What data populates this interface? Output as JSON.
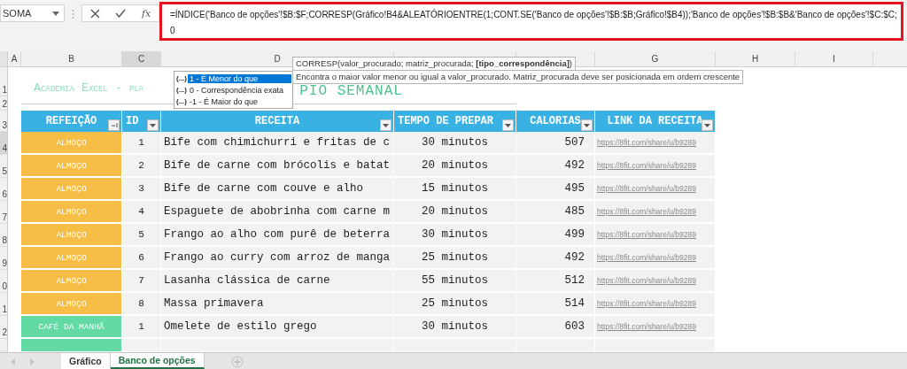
{
  "name_box": {
    "value": "SOMA"
  },
  "formula_bar": {
    "fx_label": "fx",
    "lines": [
      "=ÍNDICE('Banco de opções'!$B:$F;CORRESP(Gráfico!B4&ALEATÓRIOENTRE(1;CONT.SE('Banco de opções'!$B:$B;Gráfico!$B4));'Banco de opções'!$B:$B&'Banco de opções'!$C:$C;",
      "0"
    ]
  },
  "column_headers": [
    {
      "label": "A",
      "selected": false
    },
    {
      "label": "B",
      "selected": false
    },
    {
      "label": "C",
      "selected": true
    },
    {
      "label": "D",
      "selected": false
    },
    {
      "selected": false
    },
    {
      "selected": false
    },
    {
      "label": "G",
      "selected": false
    },
    {
      "label": "H",
      "selected": false
    },
    {
      "label": "I",
      "selected": false
    }
  ],
  "row_headers": [
    {
      "label": "1",
      "selected": false
    },
    {
      "label": "2",
      "selected": false
    },
    {
      "label": "3",
      "selected": false
    },
    {
      "label": "4",
      "selected": true
    },
    {
      "label": "5",
      "selected": false
    },
    {
      "label": "6",
      "selected": false
    },
    {
      "label": "7",
      "selected": false
    },
    {
      "label": "8",
      "selected": false
    },
    {
      "label": "9",
      "selected": false
    },
    {
      "label": "0",
      "selected": false
    },
    {
      "label": "1",
      "selected": false
    },
    {
      "label": "2",
      "selected": false
    }
  ],
  "title": {
    "left": "Academia Excel - pla",
    "right": "PIO SEMANAL"
  },
  "table": {
    "columns": [
      "REFEIÇÃO",
      "ID",
      "RECEITA",
      "TEMPO DE PREPAR",
      "CALORIAS",
      "LINK DA RECEITA"
    ],
    "rows": [
      {
        "meal": "ALMOÇO",
        "color": "#f6bd47",
        "id": "1",
        "recipe": "Bife com chimichurri e fritas de c",
        "time": "30 minutos",
        "calories": "507",
        "link": "https://8fit.com/share/u/b9289"
      },
      {
        "meal": "ALMOÇO",
        "color": "#f6bd47",
        "id": "2",
        "recipe": "Bife de carne com brócolis e batat",
        "time": "20 minutos",
        "calories": "492",
        "link": "https://8fit.com/share/u/b9289"
      },
      {
        "meal": "ALMOÇO",
        "color": "#f6bd47",
        "id": "3",
        "recipe": "Bife de carne com couve e alho",
        "time": "15 minutos",
        "calories": "495",
        "link": "https://8fit.com/share/u/b9289"
      },
      {
        "meal": "ALMOÇO",
        "color": "#f6bd47",
        "id": "4",
        "recipe": "Espaguete de abobrinha com carne m",
        "time": "20 minutos",
        "calories": "485",
        "link": "https://8fit.com/share/u/b9289"
      },
      {
        "meal": "ALMOÇO",
        "color": "#f6bd47",
        "id": "5",
        "recipe": "Frango ao alho com purê de beterra",
        "time": "30 minutos",
        "calories": "499",
        "link": "https://8fit.com/share/u/b9289"
      },
      {
        "meal": "ALMOÇO",
        "color": "#f6bd47",
        "id": "6",
        "recipe": "Frango ao curry com arroz de manga",
        "time": "25 minutos",
        "calories": "492",
        "link": "https://8fit.com/share/u/b9289"
      },
      {
        "meal": "ALMOÇO",
        "color": "#f6bd47",
        "id": "7",
        "recipe": "Lasanha clássica de carne",
        "time": "55 minutos",
        "calories": "512",
        "link": "https://8fit.com/share/u/b9289"
      },
      {
        "meal": "ALMOÇO",
        "color": "#f6bd47",
        "id": "8",
        "recipe": "Massa primavera",
        "time": "25 minutos",
        "calories": "514",
        "link": "https://8fit.com/share/u/b9289"
      },
      {
        "meal": "CAFÉ DA MANHÃ",
        "color": "#63d9a3",
        "id": "1",
        "recipe": "Omelete de estilo grego",
        "time": "30 minutos",
        "calories": "603",
        "link": "https://8fit.com/share/u/b9289"
      }
    ]
  },
  "autocomplete": {
    "items": [
      {
        "badge": "(...)",
        "label": "1 - É Menor do que",
        "selected": true
      },
      {
        "badge": "(...)",
        "label": "0 - Correspondência exata",
        "selected": false
      },
      {
        "badge": "(...)",
        "label": "-1 - É Maior do que",
        "selected": false
      }
    ]
  },
  "tooltips": {
    "syntax": "CORRESP(valor_procurado; matriz_procurada; **[tipo_correspondência]**)",
    "description": "Encontra o maior valor menor ou igual a valor_procurado. Matriz_procurada deve ser posicionada em ordem crescente"
  },
  "sheet_tabs": [
    {
      "label": "Gráfico",
      "selected": false
    },
    {
      "label": "Banco de opções",
      "selected": true
    }
  ]
}
